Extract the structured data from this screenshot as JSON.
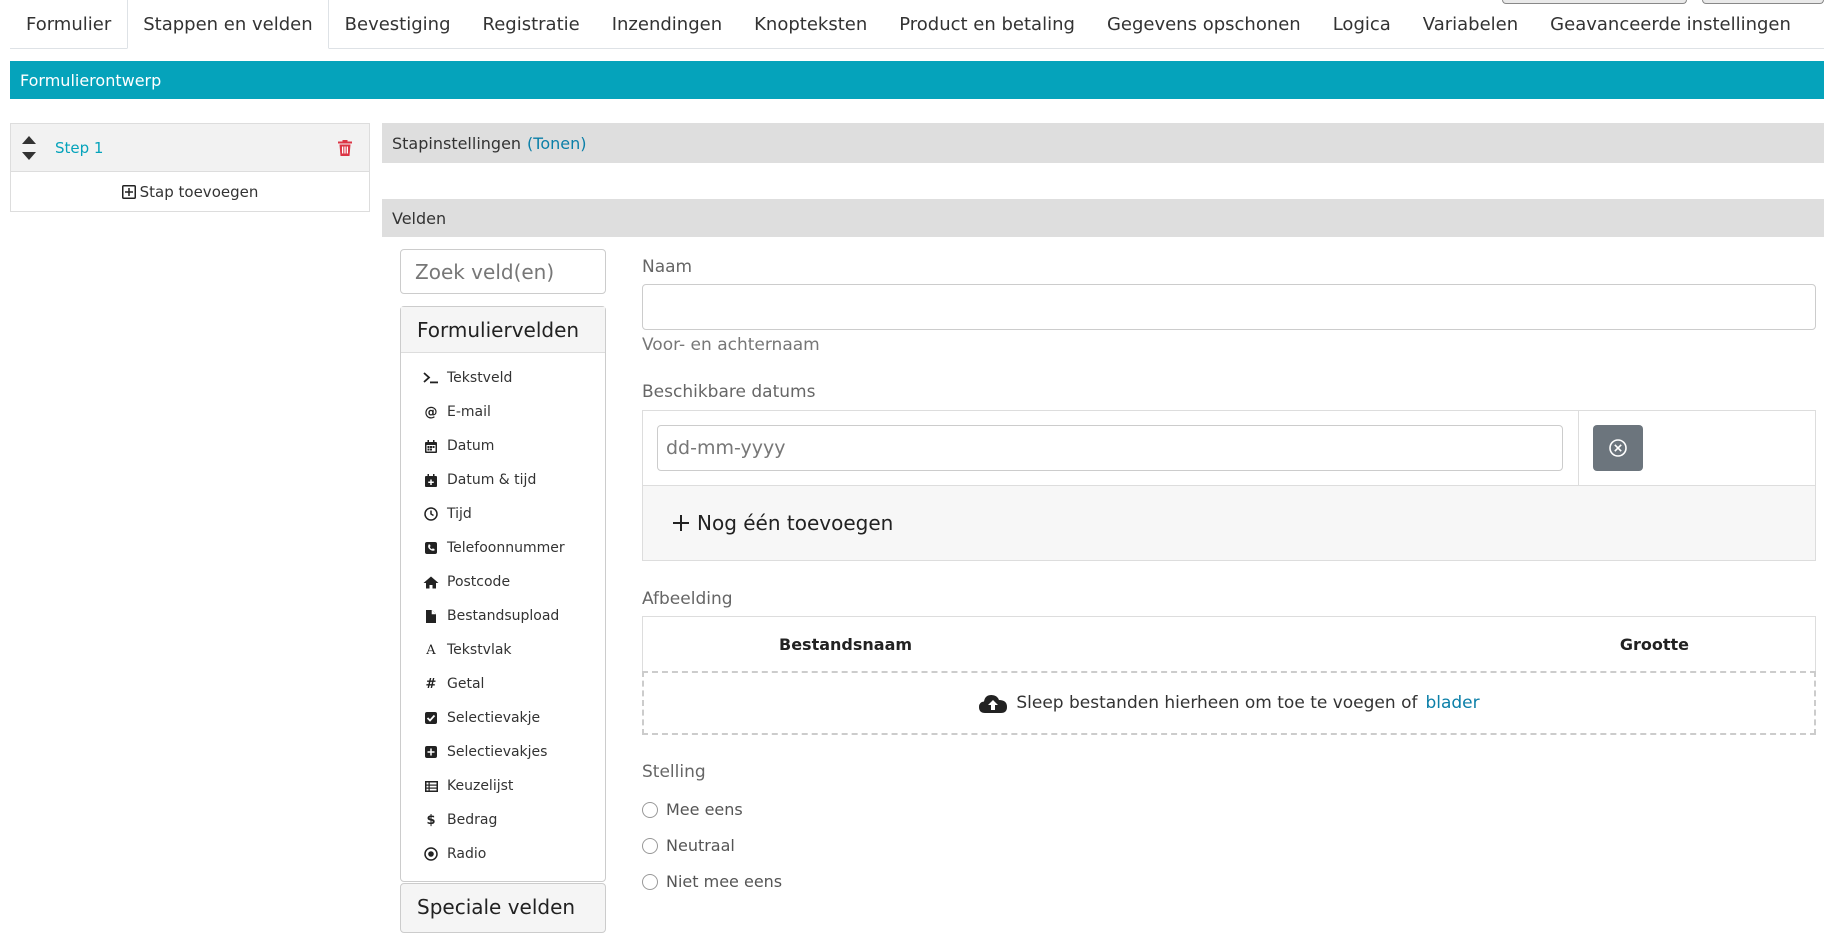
{
  "tabs": [
    {
      "label": "Formulier",
      "active": false
    },
    {
      "label": "Stappen en velden",
      "active": true
    },
    {
      "label": "Bevestiging",
      "active": false
    },
    {
      "label": "Registratie",
      "active": false
    },
    {
      "label": "Inzendingen",
      "active": false
    },
    {
      "label": "Knopteksten",
      "active": false
    },
    {
      "label": "Product en betaling",
      "active": false
    },
    {
      "label": "Gegevens opschonen",
      "active": false
    },
    {
      "label": "Logica",
      "active": false
    },
    {
      "label": "Variabelen",
      "active": false
    },
    {
      "label": "Geavanceerde instellingen",
      "active": false
    }
  ],
  "header": {
    "title": "Formulierontwerp"
  },
  "steps": {
    "items": [
      {
        "label": "Step 1"
      }
    ],
    "add_label": "Stap toevoegen"
  },
  "step_settings": {
    "label": "Stapinstellingen",
    "toggle": "(Tonen)"
  },
  "fields_section": {
    "label": "Velden"
  },
  "palette": {
    "search_placeholder": "Zoek veld(en)",
    "title": "Formuliervelden",
    "items": [
      {
        "label": "Tekstveld",
        "icon": "terminal-icon"
      },
      {
        "label": "E-mail",
        "icon": "at-icon"
      },
      {
        "label": "Datum",
        "icon": "calendar-icon"
      },
      {
        "label": "Datum & tijd",
        "icon": "calendar-plus-icon"
      },
      {
        "label": "Tijd",
        "icon": "clock-icon"
      },
      {
        "label": "Telefoonnummer",
        "icon": "phone-icon"
      },
      {
        "label": "Postcode",
        "icon": "home-icon"
      },
      {
        "label": "Bestandsupload",
        "icon": "file-icon"
      },
      {
        "label": "Tekstvlak",
        "icon": "font-icon"
      },
      {
        "label": "Getal",
        "icon": "hashtag-icon"
      },
      {
        "label": "Selectievakje",
        "icon": "check-square-icon"
      },
      {
        "label": "Selectievakjes",
        "icon": "plus-square-icon"
      },
      {
        "label": "Keuzelijst",
        "icon": "list-table-icon"
      },
      {
        "label": "Bedrag",
        "icon": "dollar-icon"
      },
      {
        "label": "Radio",
        "icon": "dot-circle-icon"
      }
    ],
    "special_title": "Speciale velden"
  },
  "preview": {
    "name": {
      "label": "Naam",
      "value": "",
      "help": "Voor- en achternaam"
    },
    "dates": {
      "label": "Beschikbare datums",
      "placeholder": "dd-mm-yyyy",
      "add_label": "Nog één toevoegen"
    },
    "image": {
      "label": "Afbeelding",
      "col_name": "Bestandsnaam",
      "col_size": "Grootte",
      "drop_text": "Sleep bestanden hierheen om toe te voegen of",
      "browse": "blader"
    },
    "statement": {
      "label": "Stelling",
      "options": [
        "Mee eens",
        "Neutraal",
        "Niet mee eens"
      ]
    }
  },
  "colors": {
    "accent": "#05a3bb",
    "link": "#0b7fa8",
    "danger": "#dc3545"
  }
}
